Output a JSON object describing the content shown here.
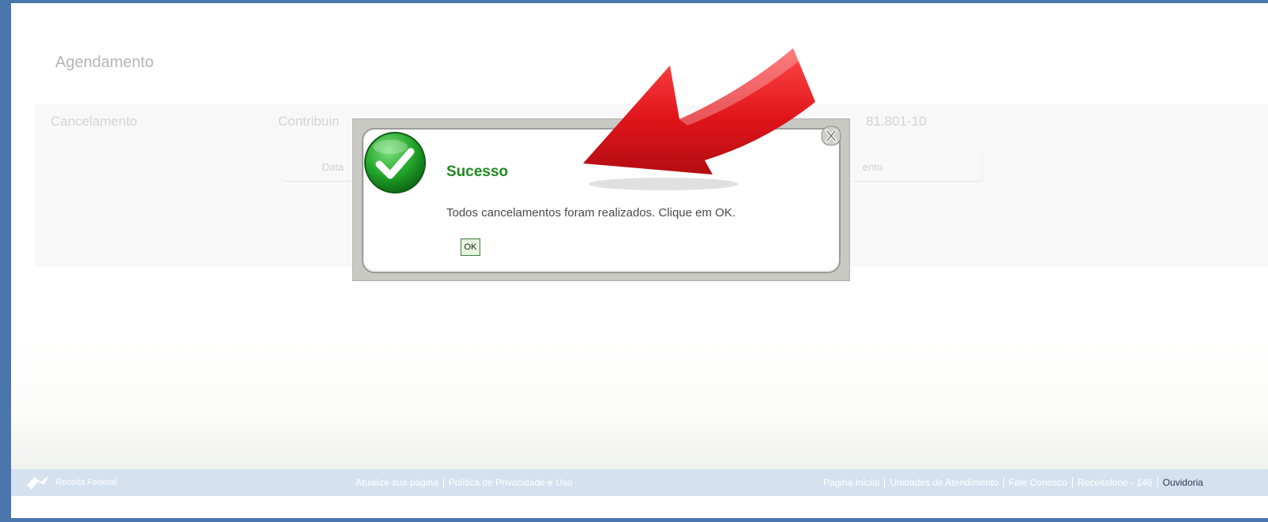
{
  "page": {
    "title": "Agendamento"
  },
  "panel": {
    "label": "Cancelamento",
    "contribuinte_label": "Contribuin",
    "cnpj_fragment": "81.801-10",
    "column_left": "Data",
    "column_right": "ento"
  },
  "footer": {
    "brand": "Receita Federal",
    "links_center": [
      "Atualize sua página",
      "Política de Privacidade e Uso"
    ],
    "links_right": [
      "Página Inicial",
      "Unidades de Atendimento",
      "Fale Conosco",
      "Receitafone - 146",
      "Ouvidoria"
    ]
  },
  "dialog": {
    "title": "Sucesso",
    "message": "Todos cancelamentos foram realizados. Clique em OK.",
    "ok_label": "OK",
    "close_icon": "close-icon",
    "status_icon": "check-icon"
  },
  "colors": {
    "frame_blue": "#4a75ad",
    "success_green": "#1f8a1f",
    "arrow_red": "#e0151b"
  }
}
